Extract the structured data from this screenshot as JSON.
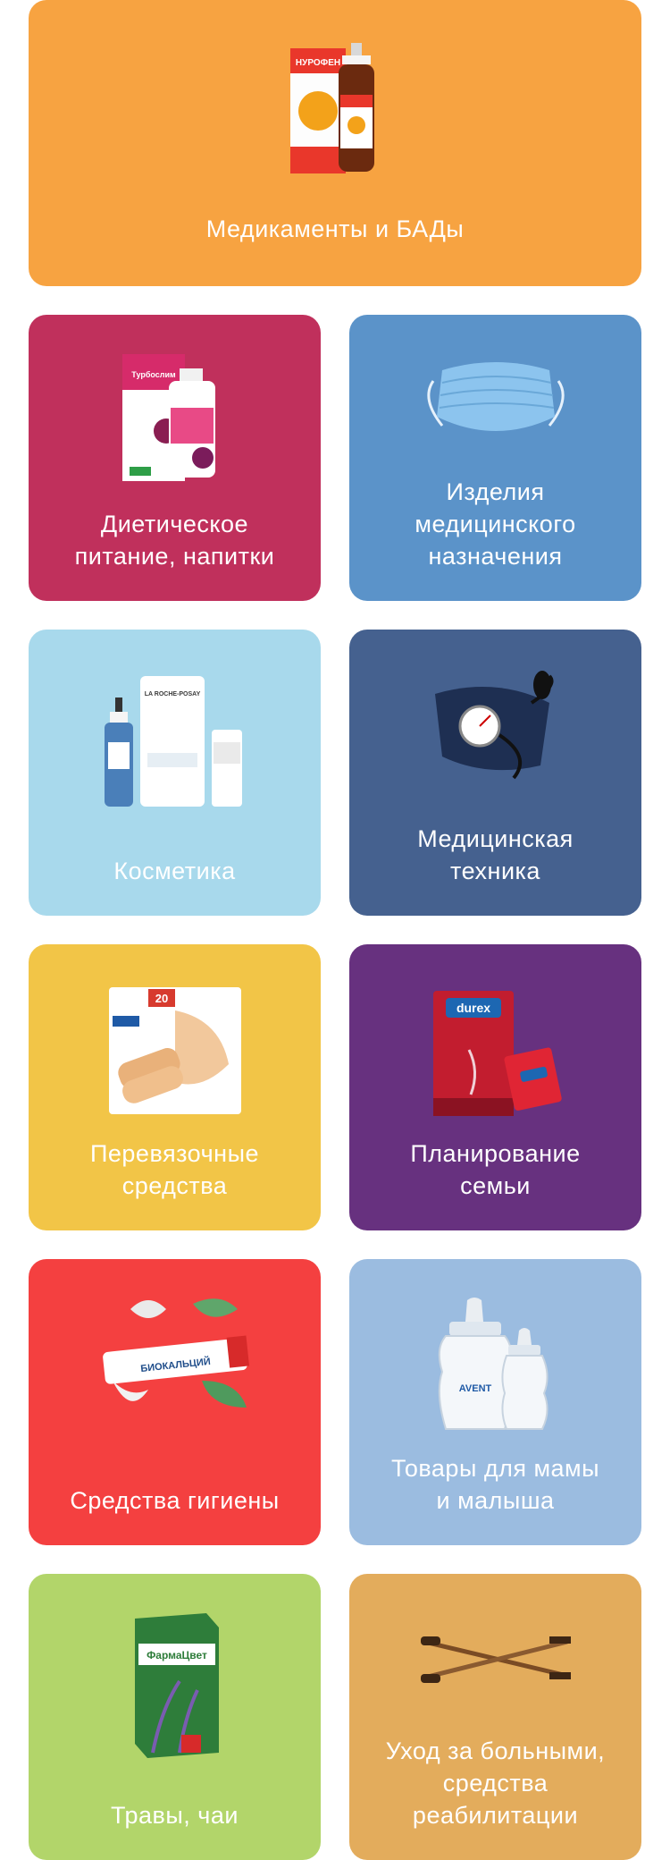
{
  "categories": [
    {
      "id": "meds",
      "label": "Медикаменты и БАДы",
      "color": "#F7A341"
    },
    {
      "id": "diet",
      "label": "Диетическое\nпитание, напитки",
      "color": "#C0305C"
    },
    {
      "id": "medical-items",
      "label": "Изделия\nмедицинского\nназначения",
      "color": "#5B93C9"
    },
    {
      "id": "cosmetics",
      "label": "Косметика",
      "color": "#A8D9EC"
    },
    {
      "id": "medical-tech",
      "label": "Медицинская\nтехника",
      "color": "#45618F"
    },
    {
      "id": "dressings",
      "label": "Перевязочные\nсредства",
      "color": "#F2C547"
    },
    {
      "id": "family-planning",
      "label": "Планирование\nсемьи",
      "color": "#67317F"
    },
    {
      "id": "hygiene",
      "label": "Средства гигиены",
      "color": "#F44040"
    },
    {
      "id": "mother-baby",
      "label": "Товары для мамы\nи малыша",
      "color": "#9BBCE0"
    },
    {
      "id": "herbs",
      "label": "Травы, чаи",
      "color": "#B2D56A"
    },
    {
      "id": "patient-care",
      "label": "Уход за больными,\nсредства\nреабилитации",
      "color": "#E3AC5C"
    }
  ],
  "product_text": {
    "nurofen": "НУРОФЕН",
    "turboslim": "Турбослим",
    "laroche": "LA ROCHE-POSAY",
    "durex": "durex",
    "bioc": "БИОКАЛЬЦИЙ",
    "avent": "AVENT",
    "farmacvet": "ФармаЦвет",
    "plaster": "20"
  }
}
